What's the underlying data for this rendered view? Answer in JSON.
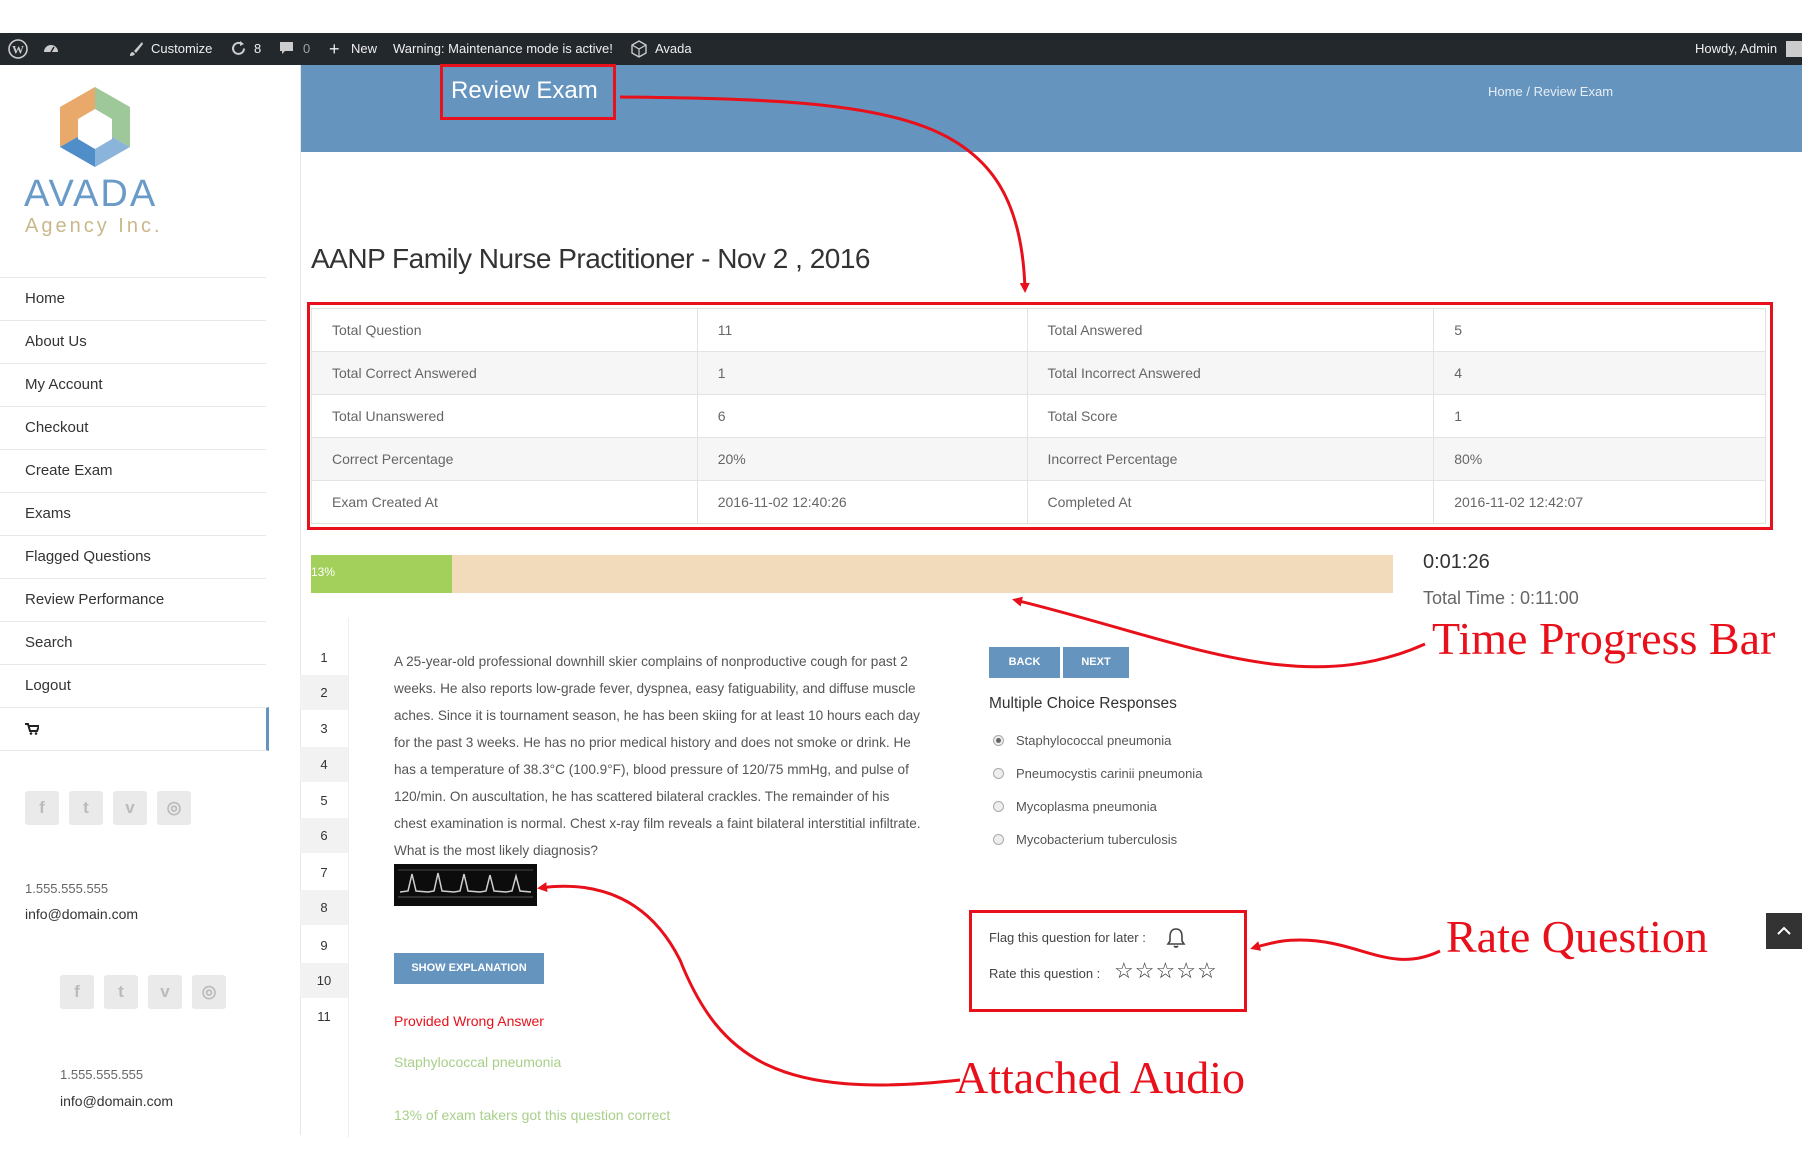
{
  "admin_bar": {
    "site_name": "",
    "customize": "Customize",
    "updates_count": "8",
    "comments_count": "0",
    "new_label": "New",
    "warning": "Warning: Maintenance mode is active!",
    "theme": "Avada",
    "howdy": "Howdy, Admin"
  },
  "logo": {
    "name": "AVADA",
    "tagline": "Agency Inc."
  },
  "sidebar": {
    "menu": [
      "Home",
      "About Us",
      "My Account",
      "Checkout",
      "Create Exam",
      "Exams",
      "Flagged Questions",
      "Review Performance",
      "Search",
      "Logout"
    ],
    "cart_icon": "cart-icon",
    "contact": {
      "phone": "1.555.555.555",
      "email": "info@domain.com"
    },
    "social": [
      "facebook-icon",
      "twitter-icon",
      "vimeo-icon",
      "instagram-icon"
    ]
  },
  "header": {
    "title": "Review Exam",
    "breadcrumb_home": "Home",
    "breadcrumb_sep": "/",
    "breadcrumb_current": "Review Exam",
    "band_color": "#6594bf"
  },
  "exam": {
    "title": "AANP Family Nurse Practitioner - Nov 2 , 2016",
    "stats": [
      [
        "Total Question",
        "11",
        "Total Answered",
        "5"
      ],
      [
        "Total Correct Answered",
        "1",
        "Total Incorrect Answered",
        "4"
      ],
      [
        "Total Unanswered",
        "6",
        "Total Score",
        "1"
      ],
      [
        "Correct Percentage",
        "20%",
        "Incorrect Percentage",
        "80%"
      ],
      [
        "Exam Created At",
        "2016-11-02 12:40:26",
        "Completed At",
        "2016-11-02 12:42:07"
      ]
    ]
  },
  "progress": {
    "percent_label": "13%",
    "fraction": 0.13,
    "elapsed": "0:01:26",
    "total_time": "Total Time : 0:11:00",
    "fill_color": "#a2d05b",
    "track_color": "#f2dbbb"
  },
  "question": {
    "numbers": [
      "1",
      "2",
      "3",
      "4",
      "5",
      "6",
      "7",
      "8",
      "9",
      "10",
      "11"
    ],
    "text_lines": [
      "A 25-year-old professional downhill skier complains of nonproductive cough for past 2",
      "weeks. He also reports low-grade fever, dyspnea, easy fatiguability, and diffuse muscle",
      "aches. Since it is tournament season, he has been skiing for at least 10 hours each day",
      "for the past 3 weeks. He has no prior medical history and does not smoke or drink. He",
      "has a temperature of 38.3°C (100.9°F), blood pressure of 120/75 mmHg, and pulse of",
      "120/min. On auscultation, he has scattered bilateral crackles. The remainder of his",
      "chest examination is normal. Chest x-ray film reveals a faint bilateral interstitial infiltrate.",
      "What is the most likely diagnosis?"
    ],
    "show_explanation": "SHOW EXPLANATION",
    "provided_wrong": "Provided Wrong Answer",
    "answer": "Staphylococcal pneumonia",
    "takers_correct": "13% of exam takers got this question correct",
    "back": "BACK",
    "next": "NEXT",
    "choices_title": "Multiple Choice Responses",
    "choices": [
      "Staphylococcal pneumonia",
      "Pneumocystis carinii pneumonia",
      "Mycoplasma pneumonia",
      "Mycobacterium tuberculosis"
    ],
    "flag_label": "Flag this question for later :",
    "rate_label": "Rate this question :",
    "stars": 5
  },
  "annotations": {
    "time_progress": "Time Progress Bar",
    "rate_question": "Rate Question",
    "attached_audio": "Attached Audio"
  }
}
